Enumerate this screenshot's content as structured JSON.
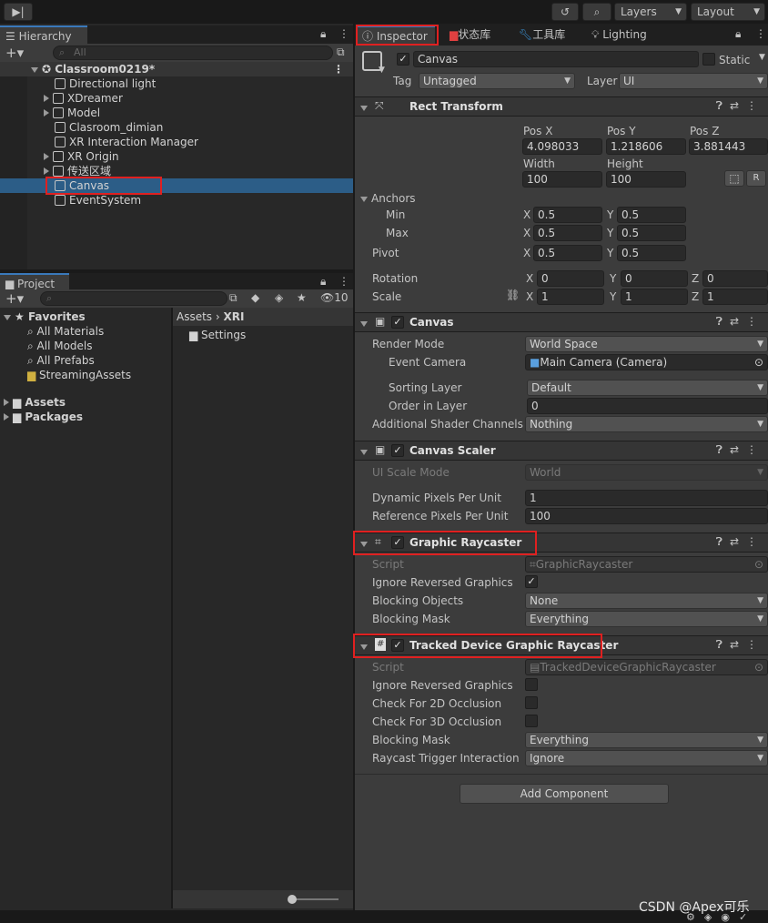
{
  "topbar": {
    "step_icon": "step-forward-icon",
    "history_icon": "history-icon",
    "search_icon": "search-icon",
    "layers_label": "Layers",
    "layout_label": "Layout"
  },
  "hierarchy": {
    "tab_label": "Hierarchy",
    "search_placeholder": "All",
    "scene": "Classroom0219*",
    "items": [
      {
        "label": "Directional light",
        "arrow": false
      },
      {
        "label": "XDreamer",
        "arrow": true
      },
      {
        "label": "Model",
        "arrow": true
      },
      {
        "label": "Clasroom_dimian",
        "arrow": false
      },
      {
        "label": "XR Interaction Manager",
        "arrow": false
      },
      {
        "label": "XR Origin",
        "arrow": true
      },
      {
        "label": "传送区域",
        "arrow": true
      },
      {
        "label": "Canvas",
        "arrow": false,
        "selected": true
      },
      {
        "label": "EventSystem",
        "arrow": false
      }
    ]
  },
  "project": {
    "tab_label": "Project",
    "hidden_count": "10",
    "favorites_label": "Favorites",
    "favorites": [
      "All Materials",
      "All Models",
      "All Prefabs",
      "StreamingAssets"
    ],
    "roots": [
      "Assets",
      "Packages"
    ],
    "breadcrumb": {
      "root": "Assets",
      "current": "XRI"
    },
    "folders": [
      "Settings"
    ]
  },
  "inspector": {
    "tabs": [
      "Inspector",
      "状态库",
      "工具库",
      "Lighting"
    ],
    "object_name": "Canvas",
    "static_label": "Static",
    "tag_label": "Tag",
    "tag_value": "Untagged",
    "layer_label": "Layer",
    "layer_value": "UI",
    "rect": {
      "title": "Rect Transform",
      "posx_label": "Pos X",
      "posy_label": "Pos Y",
      "posz_label": "Pos Z",
      "posx": "4.098033",
      "posy": "1.218606",
      "posz": "3.881443",
      "width_label": "Width",
      "height_label": "Height",
      "width": "100",
      "height": "100",
      "r_button": "R",
      "anchors_label": "Anchors",
      "min_label": "Min",
      "max_label": "Max",
      "min_x": "0.5",
      "min_y": "0.5",
      "max_x": "0.5",
      "max_y": "0.5",
      "pivot_label": "Pivot",
      "pivot_x": "0.5",
      "pivot_y": "0.5",
      "rotation_label": "Rotation",
      "rot_x": "0",
      "rot_y": "0",
      "rot_z": "0",
      "scale_label": "Scale",
      "scale_x": "1",
      "scale_y": "1",
      "scale_z": "1",
      "x": "X",
      "y": "Y",
      "z": "Z"
    },
    "canvas": {
      "title": "Canvas",
      "render_mode_label": "Render Mode",
      "render_mode": "World Space",
      "event_camera_label": "Event Camera",
      "event_camera": "Main Camera (Camera)",
      "sorting_layer_label": "Sorting Layer",
      "sorting_layer": "Default",
      "order_label": "Order in Layer",
      "order": "0",
      "shader_label": "Additional Shader Channels",
      "shader": "Nothing"
    },
    "scaler": {
      "title": "Canvas Scaler",
      "mode_label": "UI Scale Mode",
      "mode": "World",
      "dpp_label": "Dynamic Pixels Per Unit",
      "dpp": "1",
      "rpp_label": "Reference Pixels Per Unit",
      "rpp": "100"
    },
    "raycaster": {
      "title": "Graphic Raycaster",
      "script_label": "Script",
      "script": "GraphicRaycaster",
      "ignore_label": "Ignore Reversed Graphics",
      "blocking_objects_label": "Blocking Objects",
      "blocking_objects": "None",
      "blocking_mask_label": "Blocking Mask",
      "blocking_mask": "Everything"
    },
    "tracked": {
      "title": "Tracked Device Graphic Raycaster",
      "script_label": "Script",
      "script": "TrackedDeviceGraphicRaycaster",
      "ignore_label": "Ignore Reversed Graphics",
      "occ2d_label": "Check For 2D Occlusion",
      "occ3d_label": "Check For 3D Occlusion",
      "blocking_mask_label": "Blocking Mask",
      "blocking_mask": "Everything",
      "trigger_label": "Raycast Trigger Interaction",
      "trigger": "Ignore"
    },
    "add_component": "Add Component"
  },
  "watermark": "CSDN @Apex可乐",
  "colors": {
    "accent": "#3a79bb",
    "selection": "#2c5d87",
    "highlight_box": "#e02020"
  }
}
